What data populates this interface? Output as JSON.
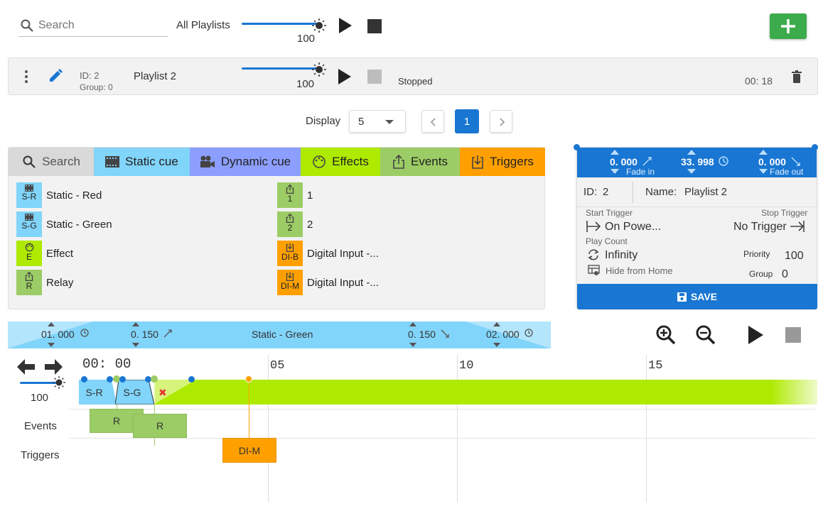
{
  "top": {
    "search_placeholder": "Search",
    "playlist_label": "All Playlists",
    "volume": "100",
    "volume_level": 1.0
  },
  "playlist_row": {
    "id": "ID: 2",
    "group": "Group: 0",
    "name": "Playlist 2",
    "volume": "100",
    "status": "Stopped",
    "time": "00: 18"
  },
  "pagination": {
    "display_label": "Display",
    "per_page": "5",
    "current_page": "1"
  },
  "library": {
    "tabs": [
      {
        "label": "Search",
        "icon": "search-icon",
        "color": "#d9d9d9"
      },
      {
        "label": "Static cue",
        "icon": "film-icon",
        "color": "#81d4fa"
      },
      {
        "label": "Dynamic cue",
        "icon": "camera-icon",
        "color": "#8c9eff"
      },
      {
        "label": "Effects",
        "icon": "palette-icon",
        "color": "#aeea00"
      },
      {
        "label": "Events",
        "icon": "share-icon",
        "color": "#9ccc65"
      },
      {
        "label": "Triggers",
        "icon": "download-icon",
        "color": "#ffa000"
      }
    ],
    "left_items": [
      {
        "code": "S-R",
        "label": "Static - Red",
        "color": "#81d4fa"
      },
      {
        "code": "S-G",
        "label": "Static - Green",
        "color": "#81d4fa"
      },
      {
        "code": "E",
        "label": "Effect",
        "color": "#aeea00"
      },
      {
        "code": "R",
        "label": "Relay",
        "color": "#9ccc65"
      }
    ],
    "right_items": [
      {
        "code": "1",
        "label": "1",
        "color": "#9ccc65"
      },
      {
        "code": "2",
        "label": "2",
        "color": "#9ccc65"
      },
      {
        "code": "DI-B",
        "label": "Digital Input -...",
        "color": "#ffa000"
      },
      {
        "code": "DI-M",
        "label": "Digital Input -...",
        "color": "#ffa000"
      }
    ]
  },
  "panel": {
    "fade_in": "0. 000",
    "fade_in_label": "Fade in",
    "duration": "33. 998",
    "fade_out": "0. 000",
    "fade_out_label": "Fade out",
    "id_label": "ID:",
    "id_value": "2",
    "name_label": "Name:",
    "name_value": "Playlist 2",
    "start_trigger_label": "Start Trigger",
    "start_trigger_value": "On Powe...",
    "stop_trigger_label": "Stop Trigger",
    "stop_trigger_value": "No Trigger",
    "play_count_label": "Play Count",
    "play_count_value": "Infinity",
    "priority_label": "Priority",
    "priority_value": "100",
    "hide_label": "Hide from Home",
    "group_label": "Group",
    "group_value": "0",
    "save_label": "SAVE"
  },
  "cue_bar": {
    "start": "01. 000",
    "fade_in": "0. 150",
    "name": "Static - Green",
    "fade_out": "0. 150",
    "end": "02. 000"
  },
  "timeline": {
    "volume": "100",
    "time": "00: 00",
    "ticks": [
      "05",
      "10",
      "15"
    ],
    "row_labels": {
      "events": "Events",
      "triggers": "Triggers"
    },
    "cues": [
      {
        "code": "S-R"
      },
      {
        "code": "S-G"
      }
    ],
    "events": [
      {
        "code": "R"
      },
      {
        "code": "R"
      }
    ],
    "triggers": [
      {
        "code": "DI-M"
      }
    ],
    "effect_color": "#aeea00"
  }
}
